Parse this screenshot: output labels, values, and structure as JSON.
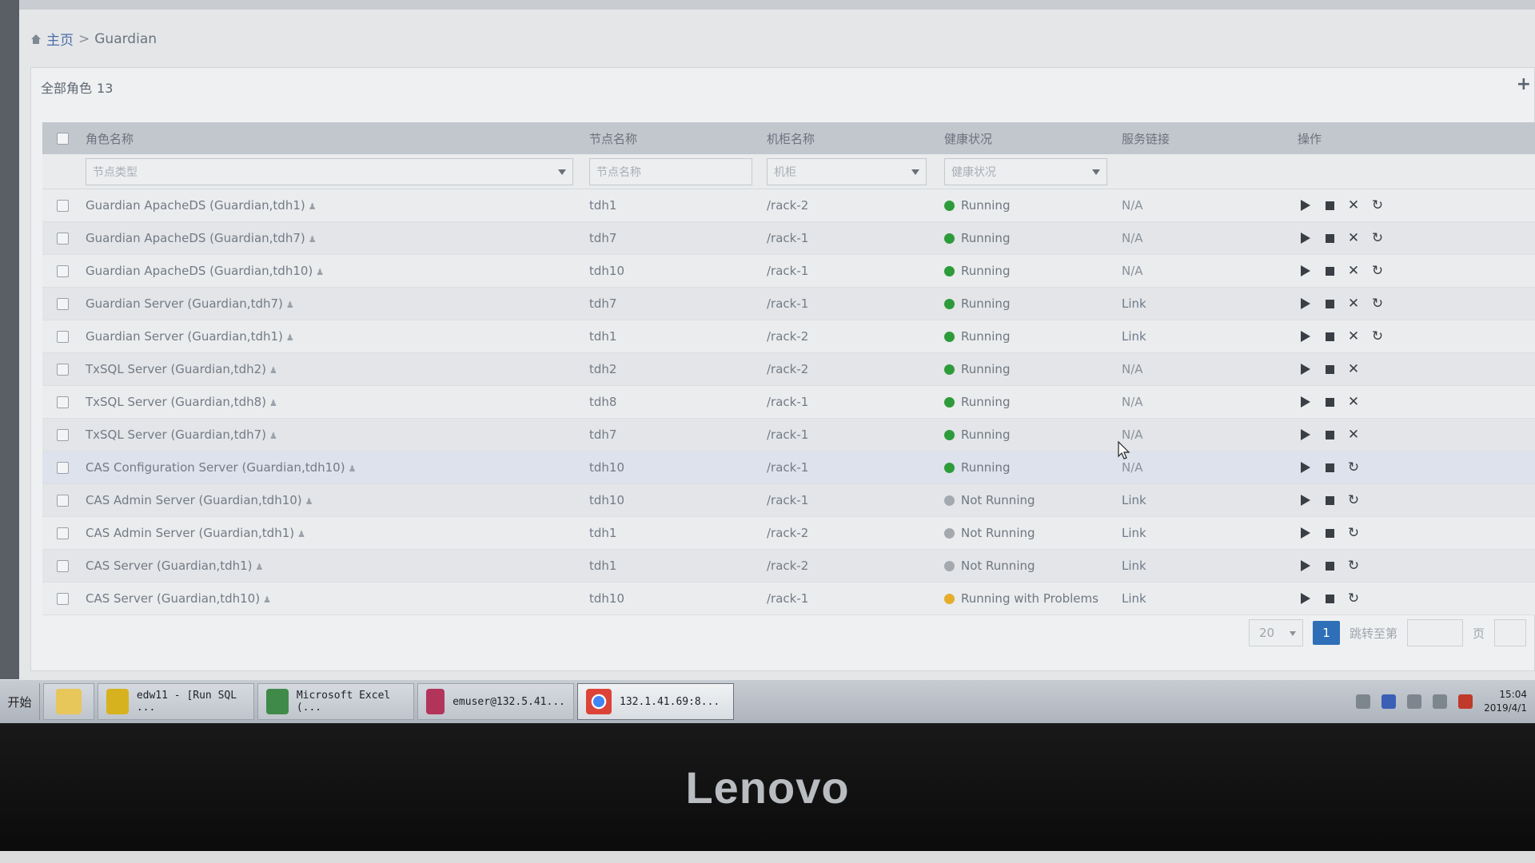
{
  "breadcrumb": {
    "home": "主页",
    "separator": ">",
    "current": "Guardian"
  },
  "panel": {
    "title": "全部角色",
    "count": "13",
    "add_icon": "+"
  },
  "columns": {
    "role": "角色名称",
    "node": "节点名称",
    "rack": "机柜名称",
    "health": "健康状况",
    "link": "服务链接",
    "ops": "操作"
  },
  "filters": {
    "role_type": "节点类型",
    "node_name": "节点名称",
    "rack": "机柜",
    "health": "健康状况"
  },
  "colors": {
    "running": "#2e9b3a",
    "not_running": "#a4a9b0",
    "problem": "#e6ad2a",
    "accent": "#2e6fb7"
  },
  "rows": [
    {
      "role": "Guardian ApacheDS (Guardian,tdh1)",
      "node": "tdh1",
      "rack": "/rack-2",
      "health": "Running",
      "status": "running",
      "link": "N/A",
      "ops": [
        "play",
        "stop",
        "delete",
        "restart"
      ]
    },
    {
      "role": "Guardian ApacheDS (Guardian,tdh7)",
      "node": "tdh7",
      "rack": "/rack-1",
      "health": "Running",
      "status": "running",
      "link": "N/A",
      "ops": [
        "play",
        "stop",
        "delete",
        "restart"
      ]
    },
    {
      "role": "Guardian ApacheDS (Guardian,tdh10)",
      "node": "tdh10",
      "rack": "/rack-1",
      "health": "Running",
      "status": "running",
      "link": "N/A",
      "ops": [
        "play",
        "stop",
        "delete",
        "restart"
      ]
    },
    {
      "role": "Guardian Server (Guardian,tdh7)",
      "node": "tdh7",
      "rack": "/rack-1",
      "health": "Running",
      "status": "running",
      "link": "Link",
      "ops": [
        "play",
        "stop",
        "delete",
        "restart"
      ]
    },
    {
      "role": "Guardian Server (Guardian,tdh1)",
      "node": "tdh1",
      "rack": "/rack-2",
      "health": "Running",
      "status": "running",
      "link": "Link",
      "ops": [
        "play",
        "stop",
        "delete",
        "restart"
      ]
    },
    {
      "role": "TxSQL Server (Guardian,tdh2)",
      "node": "tdh2",
      "rack": "/rack-2",
      "health": "Running",
      "status": "running",
      "link": "N/A",
      "ops": [
        "play",
        "stop",
        "delete"
      ]
    },
    {
      "role": "TxSQL Server (Guardian,tdh8)",
      "node": "tdh8",
      "rack": "/rack-1",
      "health": "Running",
      "status": "running",
      "link": "N/A",
      "ops": [
        "play",
        "stop",
        "delete"
      ]
    },
    {
      "role": "TxSQL Server (Guardian,tdh7)",
      "node": "tdh7",
      "rack": "/rack-1",
      "health": "Running",
      "status": "running",
      "link": "N/A",
      "ops": [
        "play",
        "stop",
        "delete"
      ]
    },
    {
      "role": "CAS Configuration Server (Guardian,tdh10)",
      "node": "tdh10",
      "rack": "/rack-1",
      "health": "Running",
      "status": "running",
      "link": "N/A",
      "ops": [
        "play",
        "stop",
        "restart"
      ],
      "highlight": true
    },
    {
      "role": "CAS Admin Server (Guardian,tdh10)",
      "node": "tdh10",
      "rack": "/rack-1",
      "health": "Not Running",
      "status": "stopped",
      "link": "Link",
      "ops": [
        "play",
        "stop",
        "restart"
      ]
    },
    {
      "role": "CAS Admin Server (Guardian,tdh1)",
      "node": "tdh1",
      "rack": "/rack-2",
      "health": "Not Running",
      "status": "stopped",
      "link": "Link",
      "ops": [
        "play",
        "stop",
        "restart"
      ]
    },
    {
      "role": "CAS Server (Guardian,tdh1)",
      "node": "tdh1",
      "rack": "/rack-2",
      "health": "Not Running",
      "status": "stopped",
      "link": "Link",
      "ops": [
        "play",
        "stop",
        "restart"
      ]
    },
    {
      "role": "CAS Server (Guardian,tdh10)",
      "node": "tdh10",
      "rack": "/rack-1",
      "health": "Running with Problems",
      "status": "problem",
      "link": "Link",
      "ops": [
        "play",
        "stop",
        "restart"
      ]
    }
  ],
  "pager": {
    "page_size": "20",
    "current_page": "1",
    "jump_label": "跳转至第",
    "page_unit": "页"
  },
  "taskbar": {
    "start": "开始",
    "items": [
      {
        "label": "",
        "icon": "folder-icon"
      },
      {
        "label": "edw11 - [Run SQL ...",
        "icon": "sql-tool-icon"
      },
      {
        "label": "Microsoft Excel (...",
        "icon": "excel-icon"
      },
      {
        "label": "emuser@132.5.41...",
        "icon": "database-icon"
      },
      {
        "label": "132.1.41.69:8...",
        "icon": "chrome-icon",
        "active": true
      }
    ],
    "time": "15:04",
    "date": "2019/4/1"
  },
  "monitor_brand": "Lenovo"
}
